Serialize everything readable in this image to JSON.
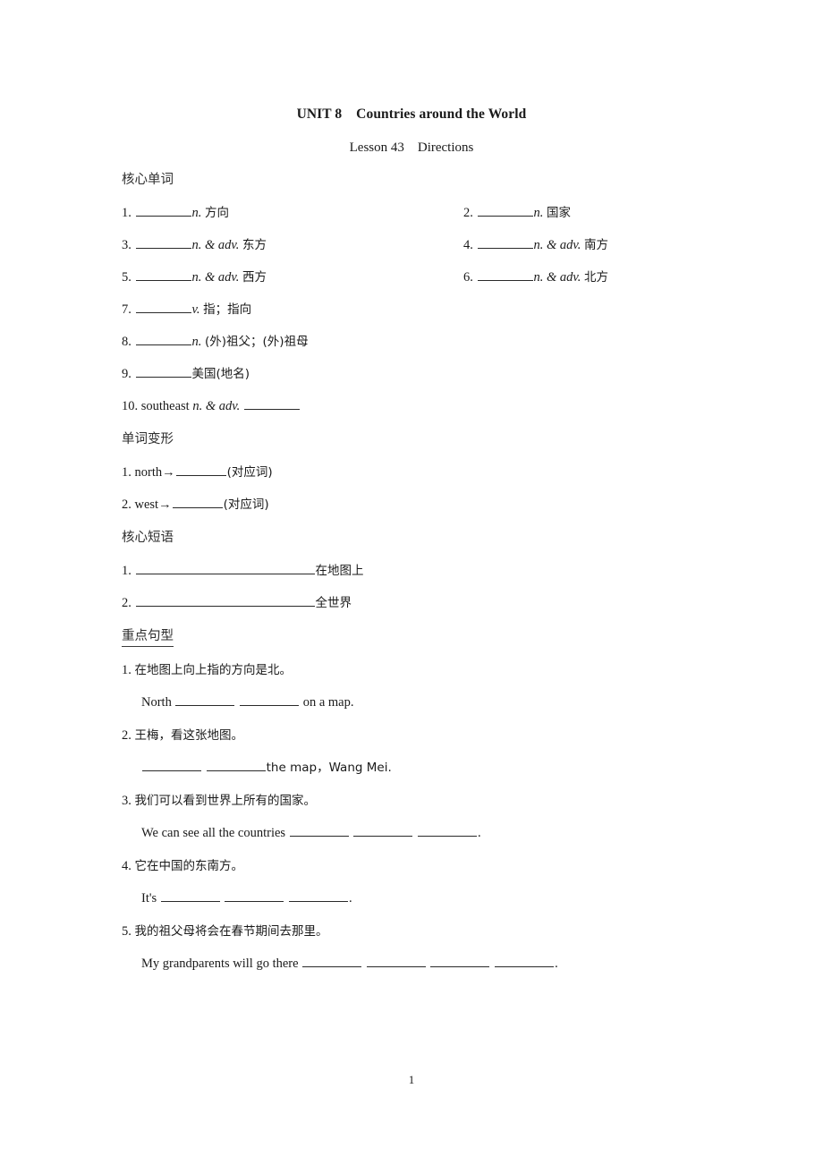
{
  "document": {
    "title": "UNIT 8    Countries around the World",
    "subtitle": "Lesson 43    Directions",
    "page_number": "1"
  },
  "sections": {
    "core_words": {
      "heading": "核心单词",
      "items": [
        {
          "num": "1.",
          "pos": "n.",
          "meaning": "方向"
        },
        {
          "num": "2.",
          "pos": "n.",
          "meaning": "国家"
        },
        {
          "num": "3.",
          "pos": "n. & adv.",
          "meaning": "东方"
        },
        {
          "num": "4.",
          "pos": "n. & adv.",
          "meaning": "南方"
        },
        {
          "num": "5.",
          "pos": "n. & adv.",
          "meaning": "西方"
        },
        {
          "num": "6.",
          "pos": "n. & adv.",
          "meaning": "北方"
        },
        {
          "num": "7.",
          "pos": "v.",
          "meaning": "指；指向"
        },
        {
          "num": "8.",
          "pos": "n.",
          "meaning": "(外)祖父；(外)祖母"
        },
        {
          "num": "9.",
          "pos": "",
          "meaning": "美国(地名)"
        },
        {
          "num": "10.",
          "word": "southeast",
          "pos": "n. & adv.",
          "meaning": ""
        }
      ]
    },
    "word_forms": {
      "heading": "单词变形",
      "items": [
        {
          "num": "1.",
          "word": "north→",
          "note": "(对应词)"
        },
        {
          "num": "2.",
          "word": "west→",
          "note": "(对应词)"
        }
      ]
    },
    "core_phrases": {
      "heading": "核心短语",
      "items": [
        {
          "num": "1.",
          "meaning": "在地图上"
        },
        {
          "num": "2.",
          "meaning": "全世界"
        }
      ]
    },
    "key_sentences": {
      "heading": "重点句型",
      "items": [
        {
          "num": "1.",
          "cn": "在地图上向上指的方向是北。",
          "en_pre": "North ",
          "blanks": 2,
          "en_post": " on a map."
        },
        {
          "num": "2.",
          "cn": "王梅，看这张地图。",
          "en_pre": "",
          "blanks": 2,
          "en_post": "the map，Wang Mei."
        },
        {
          "num": "3.",
          "cn": "我们可以看到世界上所有的国家。",
          "en_pre": "We can see all the countries ",
          "blanks": 3,
          "en_post": "."
        },
        {
          "num": "4.",
          "cn": "它在中国的东南方。",
          "en_pre": "It's ",
          "blanks": 3,
          "en_post": "."
        },
        {
          "num": "5.",
          "cn": "我的祖父母将会在春节期间去那里。",
          "en_pre": "My grandparents will go there ",
          "blanks": 4,
          "en_post": "."
        }
      ]
    }
  }
}
